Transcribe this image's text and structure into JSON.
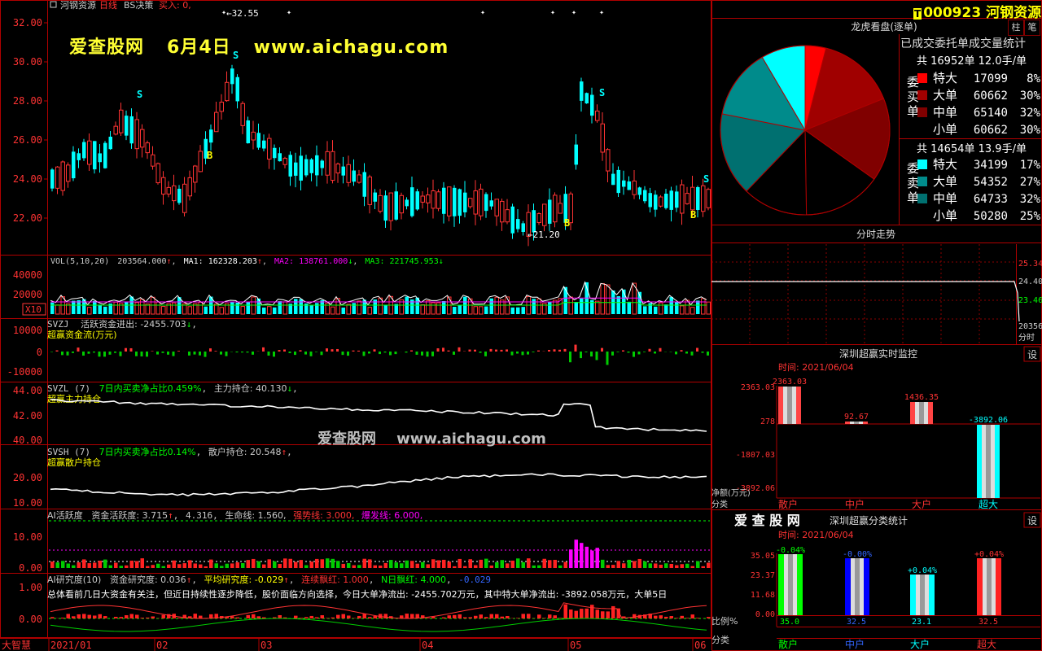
{
  "watermark": {
    "site_name": "爱查股网",
    "date": "6月4日",
    "url": "www.aichagu.com"
  },
  "mid_watermark": {
    "site_name": "爱查股网",
    "url": "www.aichagu.com"
  },
  "header": {
    "stock_name": "河钢资源",
    "period": "日线",
    "strategy": "BS决策",
    "signal": "买入: 0,"
  },
  "price_panel": {
    "y_labels": [
      "32.00",
      "30.00",
      "28.00",
      "26.00",
      "24.00",
      "22.00"
    ],
    "high_label": "32.55",
    "low_label": "21.20",
    "buy_marker": "B",
    "sell_marker": "S"
  },
  "vol_panel": {
    "title": "VOL(5,10,20)",
    "vol_value": "203564.000",
    "ma1": "MA1: 162328.203",
    "ma2": "MA2: 138761.000",
    "ma3": "MA3: 221745.953",
    "y_labels": [
      "40000",
      "20000"
    ],
    "unit": "X10"
  },
  "svzj_panel": {
    "title": "SVZJ",
    "line1": "活跃资金进出: -2455.703",
    "line2": "超赢资金流(万元)",
    "y_labels": [
      "10000",
      "0",
      "-10000"
    ]
  },
  "svzl_panel": {
    "title": "SVZL (7)",
    "ratio": "7日内买卖净占比0.459%",
    "holding": "主力持仓: 40.130",
    "sub": "超赢主力持仓",
    "y_labels": [
      "44.00",
      "42.00",
      "40.00"
    ]
  },
  "svsh_panel": {
    "title": "SVSH (7)",
    "ratio": "7日内买卖净占比0.14%",
    "holding": "散户持仓: 20.548",
    "sub": "超赢散户持仓",
    "y_labels": [
      "20.00",
      "10.00"
    ]
  },
  "ai_active_panel": {
    "title": "AI活跃度",
    "capital": "资金活跃度: 3.715",
    "v2": "4.316,",
    "life": "生命线: 1.560,",
    "strong": "强势线: 3.000,",
    "burst": "爆发线: 6.000,",
    "y_labels": [
      "10.00",
      "0.00"
    ]
  },
  "ai_research_panel": {
    "title": "AI研究度(10)",
    "research": "资金研究度: 0.036",
    "avg": "平均研究度: -0.029",
    "streak": "连续飘红: 1.000",
    "n_days": "N日飘红: 4.000",
    "last": "-0.029",
    "summary": "总体看前几日大资金有关注，但近日持续性逐步降低，股价面临方向选择，今日大单净流出: -2455.702万元，其中特大单净流出: -3892.058万元，大单5日",
    "y_labels": [
      "1.00",
      "0.00"
    ]
  },
  "x_axis": {
    "labels": [
      "2021/01",
      "02",
      "03",
      "04",
      "05",
      "06"
    ],
    "app_name": "大智慧"
  },
  "right_panel": {
    "stock_code": "000923",
    "stock_name": "河钢资源",
    "btn_zhu": "柱",
    "btn_bi": "笔",
    "lhb_title": "龙虎看盘(逐单)",
    "stats_title": "已成交委托单成交量统计",
    "buy_header": "共 16952单 12.0手/单",
    "buy_label": "委买单",
    "buy_rows": [
      {
        "name": "特大",
        "value": "17099",
        "pct": "8%",
        "color": "#ff0000"
      },
      {
        "name": "大单",
        "value": "60662",
        "pct": "30%",
        "color": "#a00000"
      },
      {
        "name": "中单",
        "value": "65140",
        "pct": "32%",
        "color": "#800000"
      },
      {
        "name": "小单",
        "value": "60662",
        "pct": "30%",
        "color": "#000000"
      }
    ],
    "sell_header": "共 14654单 13.9手/单",
    "sell_label": "委卖单",
    "sell_rows": [
      {
        "name": "特大",
        "value": "34199",
        "pct": "17%",
        "color": "#00ffff"
      },
      {
        "name": "大单",
        "value": "54352",
        "pct": "27%",
        "color": "#008b8b"
      },
      {
        "name": "中单",
        "value": "64733",
        "pct": "32%",
        "color": "#007070"
      },
      {
        "name": "小单",
        "value": "50280",
        "pct": "25%",
        "color": "#000000"
      }
    ],
    "intraday_title": "分时走势",
    "intraday_y": [
      "25.34",
      "24.40",
      "23.46",
      "20356",
      "分时"
    ],
    "monitor_title": "深圳超赢实时监控",
    "monitor_btn": "设",
    "monitor_time": "时间: 2021/06/04",
    "monitor_y": [
      "2363.03",
      "278",
      "-1807.03",
      "-3892.06"
    ],
    "monitor_bar_labels": [
      "2363.03",
      "92.67",
      "1436.35",
      "-3892.06"
    ],
    "monitor_unit": "净额(万元)",
    "monitor_cat_label": "分类",
    "monitor_categories": [
      "散户",
      "中户",
      "大户",
      "超大"
    ],
    "class_site": "爱 查 股 网",
    "class_title": "深圳超赢分类统计",
    "class_btn": "设",
    "class_time": "时间: 2021/06/04",
    "class_y": [
      "35.05",
      "23.37",
      "11.68",
      "0.00"
    ],
    "class_top_labels": [
      "-0.04%",
      "-0.00%",
      "+0.04%",
      "+0.04%"
    ],
    "class_bottom_labels": [
      "35.0",
      "32.5",
      "23.1",
      "32.5"
    ],
    "class_ratio_label": "比例%",
    "class_cat_label": "分类",
    "class_categories": [
      "散户",
      "中户",
      "大户",
      "超大"
    ]
  },
  "colors": {
    "up": "#ff3333",
    "down": "#00ffff",
    "grid": "#8b0000",
    "label_yellow": "#ffff00",
    "ma1": "#ffffff",
    "ma2": "#ff00ff",
    "ma3": "#00ff00"
  }
}
